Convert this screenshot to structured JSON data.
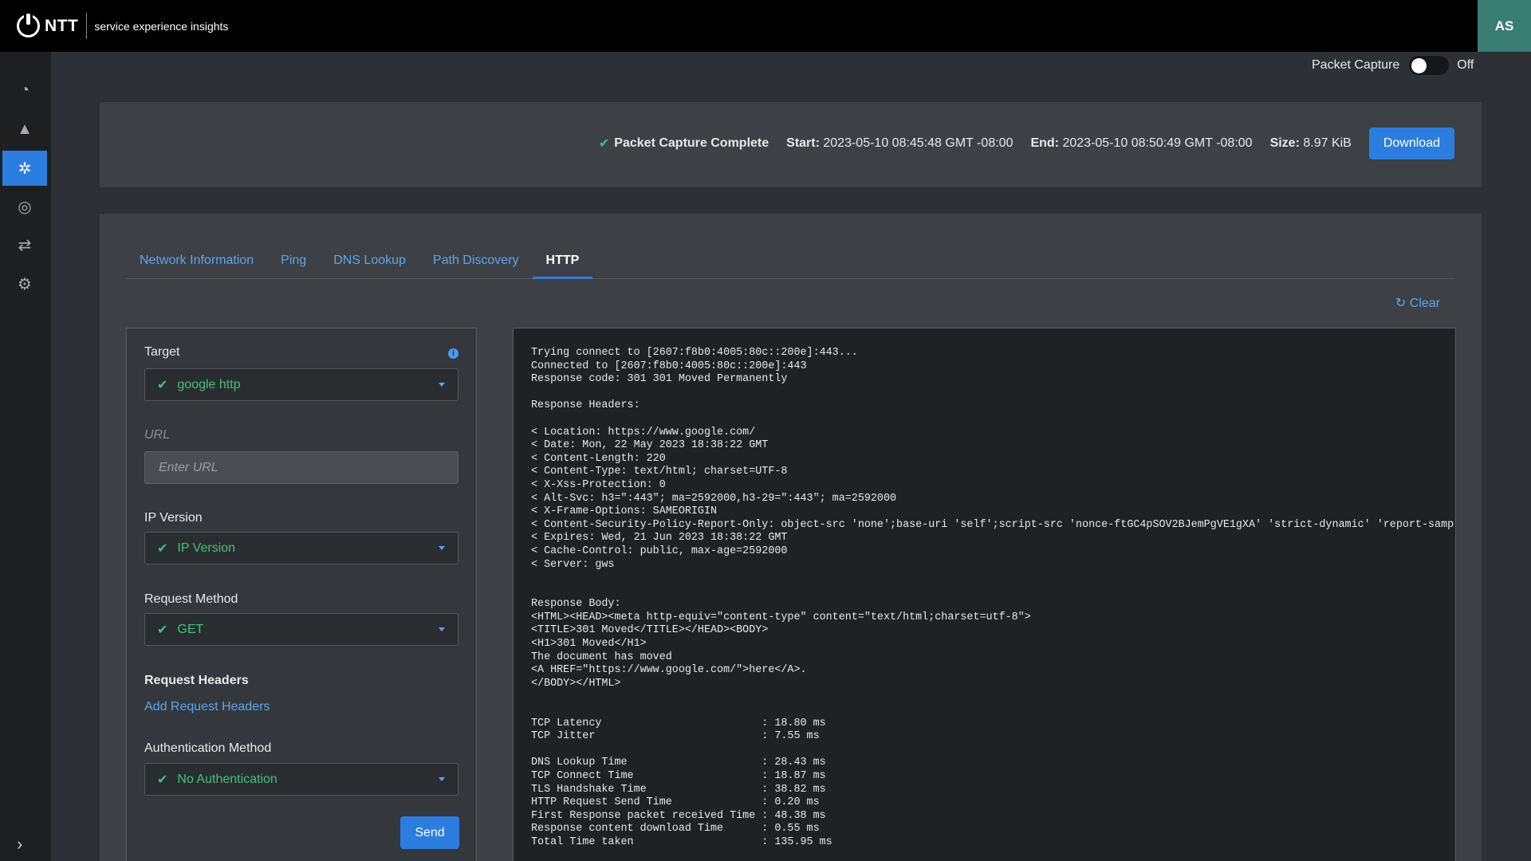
{
  "header": {
    "brand": "NTT",
    "subtitle": "service experience insights",
    "avatar_initials": "AS"
  },
  "sidebar": {
    "items": [
      {
        "name": "dashboard",
        "icon": "gauge-icon",
        "glyph": "◔",
        "active": false
      },
      {
        "name": "alerts",
        "icon": "warning-icon",
        "glyph": "▲",
        "active": false
      },
      {
        "name": "troubleshooting",
        "icon": "network-tools-icon",
        "glyph": "✲",
        "active": true
      },
      {
        "name": "radar",
        "icon": "fingerprint-icon",
        "glyph": "◎",
        "active": false
      },
      {
        "name": "transfers",
        "icon": "swap-arrows-icon",
        "glyph": "⇄",
        "active": false
      },
      {
        "name": "settings",
        "icon": "gear-icon",
        "glyph": "⚙",
        "active": false
      }
    ],
    "expand_glyph": "›"
  },
  "packet_capture": {
    "label": "Packet Capture",
    "state": "Off"
  },
  "status": {
    "title": "Packet Capture Complete",
    "start_label": "Start:",
    "start_value": "2023-05-10 08:45:48 GMT -08:00",
    "end_label": "End:",
    "end_value": "2023-05-10 08:50:49 GMT -08:00",
    "size_label": "Size:",
    "size_value": "8.97 KiB",
    "download_label": "Download"
  },
  "tabs": [
    "Network Information",
    "Ping",
    "DNS Lookup",
    "Path Discovery",
    "HTTP"
  ],
  "active_tab": "HTTP",
  "clear_label": "Clear",
  "form": {
    "target_label": "Target",
    "target_value": "google http",
    "url_label": "URL",
    "url_placeholder": "Enter URL",
    "ip_version_label": "IP Version",
    "ip_version_value": "IP Version",
    "request_method_label": "Request Method",
    "request_method_value": "GET",
    "request_headers_label": "Request Headers",
    "add_headers_label": "Add Request Headers",
    "auth_method_label": "Authentication Method",
    "auth_method_value": "No Authentication",
    "send_label": "Send"
  },
  "output": {
    "text": "Trying connect to [2607:f8b0:4005:80c::200e]:443...\nConnected to [2607:f8b0:4005:80c::200e]:443\nResponse code: 301 301 Moved Permanently\n\nResponse Headers:\n\n< Location: https://www.google.com/\n< Date: Mon, 22 May 2023 18:38:22 GMT\n< Content-Length: 220\n< Content-Type: text/html; charset=UTF-8\n< X-Xss-Protection: 0\n< Alt-Svc: h3=\":443\"; ma=2592000,h3-29=\":443\"; ma=2592000\n< X-Frame-Options: SAMEORIGIN\n< Content-Security-Policy-Report-Only: object-src 'none';base-uri 'self';script-src 'nonce-ftGC4pSOV2BJemPgVE1gXA' 'strict-dynamic' 'report-sample' 'unsafe-eval' 'unsafe-inline' https: http:;report-uri https://csp.withgoogle.com/csp/gws/other-hp\n< Expires: Wed, 21 Jun 2023 18:38:22 GMT\n< Cache-Control: public, max-age=2592000\n< Server: gws\n\n\nResponse Body:\n<HTML><HEAD><meta http-equiv=\"content-type\" content=\"text/html;charset=utf-8\">\n<TITLE>301 Moved</TITLE></HEAD><BODY>\n<H1>301 Moved</H1>\nThe document has moved\n<A HREF=\"https://www.google.com/\">here</A>.\n</BODY></HTML>\n\n\nTCP Latency                         : 18.80 ms\nTCP Jitter                          : 7.55 ms\n\nDNS Lookup Time                     : 28.43 ms\nTCP Connect Time                    : 18.87 ms\nTLS Handshake Time                  : 38.82 ms\nHTTP Request Send Time              : 0.20 ms\nFirst Response packet received Time : 48.38 ms\nResponse content download Time      : 0.55 ms\nTotal Time taken                    : 135.95 ms"
  },
  "colors": {
    "accent": "#2b7de0",
    "link": "#5aa7ef",
    "success": "#3ec47a",
    "avatar_bg": "#3a7d73"
  }
}
